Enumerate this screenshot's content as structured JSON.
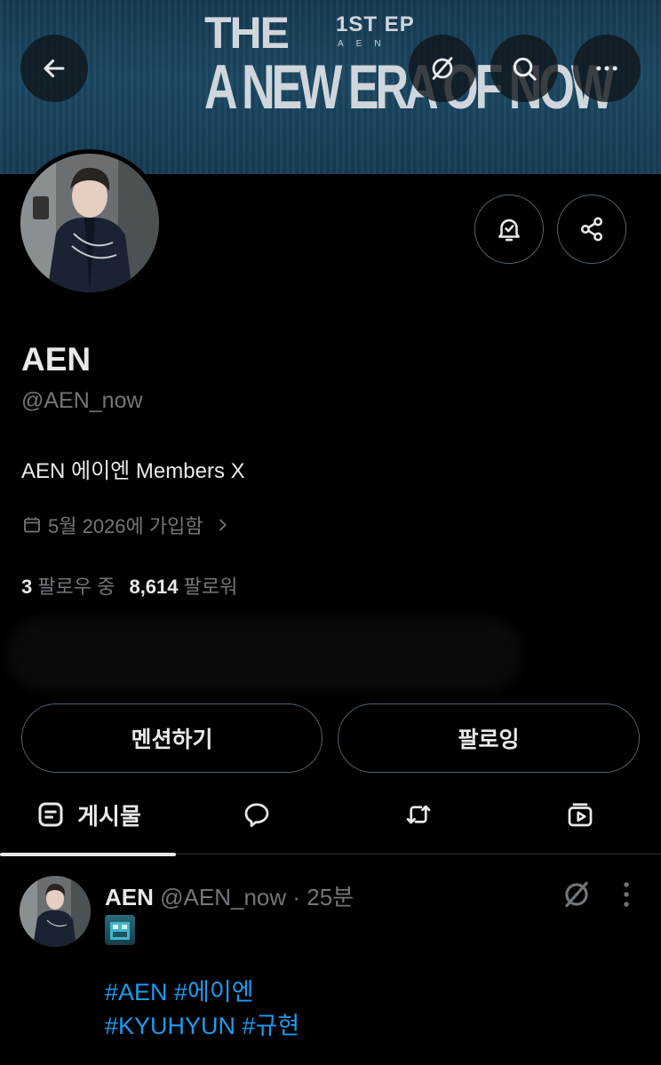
{
  "banner": {
    "line1": "THE",
    "ep": "1ST EP",
    "brand": "AEN",
    "line2": "A NEW ERA OF NOW"
  },
  "toolbar": {
    "back_icon": "arrow-left-icon",
    "grok_icon": "grok-slash-circle-icon",
    "search_icon": "search-icon",
    "more_icon": "more-horizontal-icon"
  },
  "profile": {
    "name": "AEN",
    "handle": "@AEN_now",
    "bio": "AEN 에이엔 Members X",
    "joined": "5월 2026에 가입함",
    "following_count": "3",
    "following_label": "팔로우 중",
    "followers_count": "8,614",
    "followers_label": "팔로워"
  },
  "actions": {
    "notify_icon": "bell-check-icon",
    "share_icon": "share-icon",
    "mention_label": "멘션하기",
    "following_label": "팔로잉"
  },
  "tabs": [
    {
      "label": "게시물",
      "icon": "posts-icon",
      "active": true
    },
    {
      "label": "",
      "icon": "reply-bubble-icon",
      "active": false
    },
    {
      "label": "",
      "icon": "repost-icon",
      "active": false
    },
    {
      "label": "",
      "icon": "media-icon",
      "active": false
    }
  ],
  "post": {
    "author": "AEN",
    "handle": "@AEN_now",
    "separator": "·",
    "time": "25분",
    "hashtags_line1": "#AEN #에이엔",
    "hashtags_line2": "#KYUHYUN #규현"
  },
  "colors": {
    "background": "#000000",
    "text": "#e7e9ea",
    "muted": "#71767b",
    "border": "#536471",
    "link": "#1d9bf0",
    "banner": "#1b4862"
  }
}
